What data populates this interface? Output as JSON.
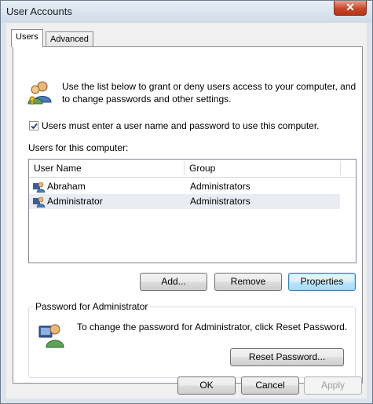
{
  "window": {
    "title": "User Accounts",
    "close_symbol": "✕"
  },
  "tabs": [
    {
      "label": "Users",
      "active": true
    },
    {
      "label": "Advanced",
      "active": false
    }
  ],
  "intro": {
    "text": "Use the list below to grant or deny users access to your computer, and to change passwords and other settings."
  },
  "checkbox": {
    "label": "Users must enter a user name and password to use this computer.",
    "checked": true
  },
  "users_section": {
    "label": "Users for this computer:",
    "columns": [
      "User Name",
      "Group"
    ],
    "rows": [
      {
        "name": "Abraham",
        "group": "Administrators",
        "selected": false
      },
      {
        "name": "Administrator",
        "group": "Administrators",
        "selected": true
      }
    ]
  },
  "list_buttons": {
    "add": "Add...",
    "remove": "Remove",
    "properties": "Properties"
  },
  "password_group": {
    "title": "Password for Administrator",
    "text": "To change the password for Administrator, click Reset Password.",
    "reset_button": "Reset Password..."
  },
  "dialog_buttons": {
    "ok": "OK",
    "cancel": "Cancel",
    "apply": "Apply"
  },
  "colors": {
    "accent": "#3c7fb1",
    "close_red": "#c9462a",
    "selection": "#e9ecf2"
  },
  "icons": [
    "users-icon",
    "check-icon",
    "user-icon",
    "key-user-icon",
    "close-icon"
  ]
}
